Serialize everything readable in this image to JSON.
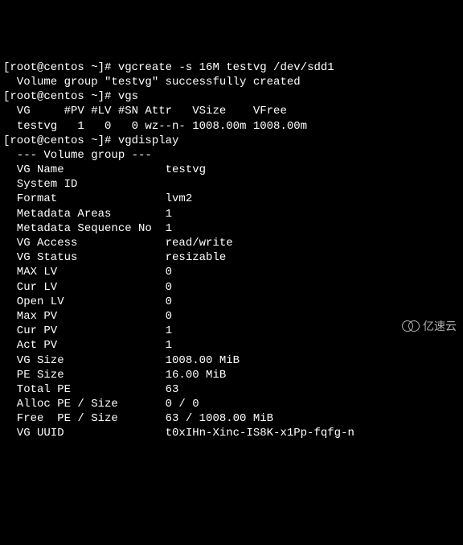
{
  "prompt_prefix": "[root@centos ~]# ",
  "cmd1": "vgcreate -s 16M testvg /dev/sdd1",
  "cmd1_out": "  Volume group \"testvg\" successfully created",
  "cmd2": "vgs",
  "vgs_header": "  VG     #PV #LV #SN Attr   VSize    VFree",
  "vgs_row": "  testvg   1   0   0 wz--n- 1008.00m 1008.00m",
  "cmd3": "vgdisplay",
  "vgdisplay_header": "  --- Volume group ---",
  "rows": [
    {
      "label": "  VG Name",
      "value": "testvg"
    },
    {
      "label": "  System ID",
      "value": ""
    },
    {
      "label": "  Format",
      "value": "lvm2"
    },
    {
      "label": "  Metadata Areas",
      "value": "1"
    },
    {
      "label": "  Metadata Sequence No",
      "value": "1"
    },
    {
      "label": "  VG Access",
      "value": "read/write"
    },
    {
      "label": "  VG Status",
      "value": "resizable"
    },
    {
      "label": "  MAX LV",
      "value": "0"
    },
    {
      "label": "  Cur LV",
      "value": "0"
    },
    {
      "label": "  Open LV",
      "value": "0"
    },
    {
      "label": "  Max PV",
      "value": "0"
    },
    {
      "label": "  Cur PV",
      "value": "1"
    },
    {
      "label": "  Act PV",
      "value": "1"
    },
    {
      "label": "  VG Size",
      "value": "1008.00 MiB"
    },
    {
      "label": "  PE Size",
      "value": "16.00 MiB"
    },
    {
      "label": "  Total PE",
      "value": "63"
    },
    {
      "label": "  Alloc PE / Size",
      "value": "0 / 0"
    },
    {
      "label": "  Free  PE / Size",
      "value": "63 / 1008.00 MiB"
    },
    {
      "label": "  VG UUID",
      "value": "t0xIHn-Xinc-IS8K-x1Pp-fqfg-n"
    }
  ],
  "watermark_text": "亿速云"
}
